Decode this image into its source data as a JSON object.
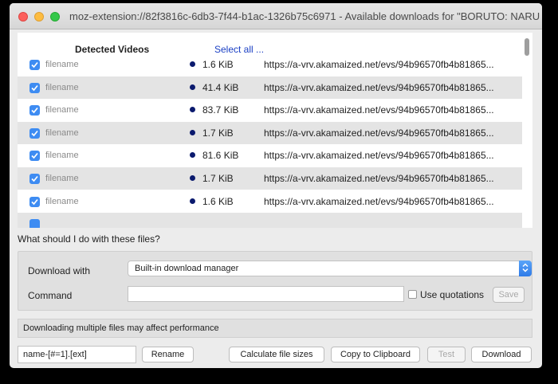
{
  "window": {
    "title": "moz-extension://82f3816c-6db3-7f44-b1ac-1326b75c6971 - Available downloads for \"BORUTO: NARU..."
  },
  "list": {
    "header_detected": "Detected Videos",
    "header_select_all": "Select all ...",
    "rows": [
      {
        "checked": true,
        "filename": "filename",
        "size": "1.6 KiB",
        "url": "https://a-vrv.akamaized.net/evs/94b96570fb4b81865..."
      },
      {
        "checked": true,
        "filename": "filename",
        "size": "41.4 KiB",
        "url": "https://a-vrv.akamaized.net/evs/94b96570fb4b81865..."
      },
      {
        "checked": true,
        "filename": "filename",
        "size": "83.7 KiB",
        "url": "https://a-vrv.akamaized.net/evs/94b96570fb4b81865..."
      },
      {
        "checked": true,
        "filename": "filename",
        "size": "1.7 KiB",
        "url": "https://a-vrv.akamaized.net/evs/94b96570fb4b81865..."
      },
      {
        "checked": true,
        "filename": "filename",
        "size": "81.6 KiB",
        "url": "https://a-vrv.akamaized.net/evs/94b96570fb4b81865..."
      },
      {
        "checked": true,
        "filename": "filename",
        "size": "1.7 KiB",
        "url": "https://a-vrv.akamaized.net/evs/94b96570fb4b81865..."
      },
      {
        "checked": true,
        "filename": "filename",
        "size": "1.6 KiB",
        "url": "https://a-vrv.akamaized.net/evs/94b96570fb4b81865..."
      }
    ]
  },
  "options": {
    "question": "What should I do with these files?",
    "download_with_label": "Download with",
    "download_with_value": "Built-in download manager",
    "command_label": "Command",
    "command_value": "",
    "use_quotations_label": "Use quotations",
    "use_quotations_checked": false,
    "save_label": "Save"
  },
  "warning": "Downloading multiple files may affect performance",
  "footer": {
    "pattern_value": "name-[#=1].[ext]",
    "rename_label": "Rename",
    "calc_sizes_label": "Calculate file sizes",
    "copy_label": "Copy to Clipboard",
    "test_label": "Test",
    "download_label": "Download"
  },
  "colors": {
    "checkbox": "#3e8cf2",
    "link": "#1a3fc4",
    "status_dot": "#0b1a6e",
    "row_alt": "#e4e4e4"
  },
  "icons": {
    "close": "traffic-light-close",
    "minimize": "traffic-light-minimize",
    "maximize": "traffic-light-maximize",
    "checkbox": "checkmark-icon",
    "select": "updown-chevron-icon"
  }
}
